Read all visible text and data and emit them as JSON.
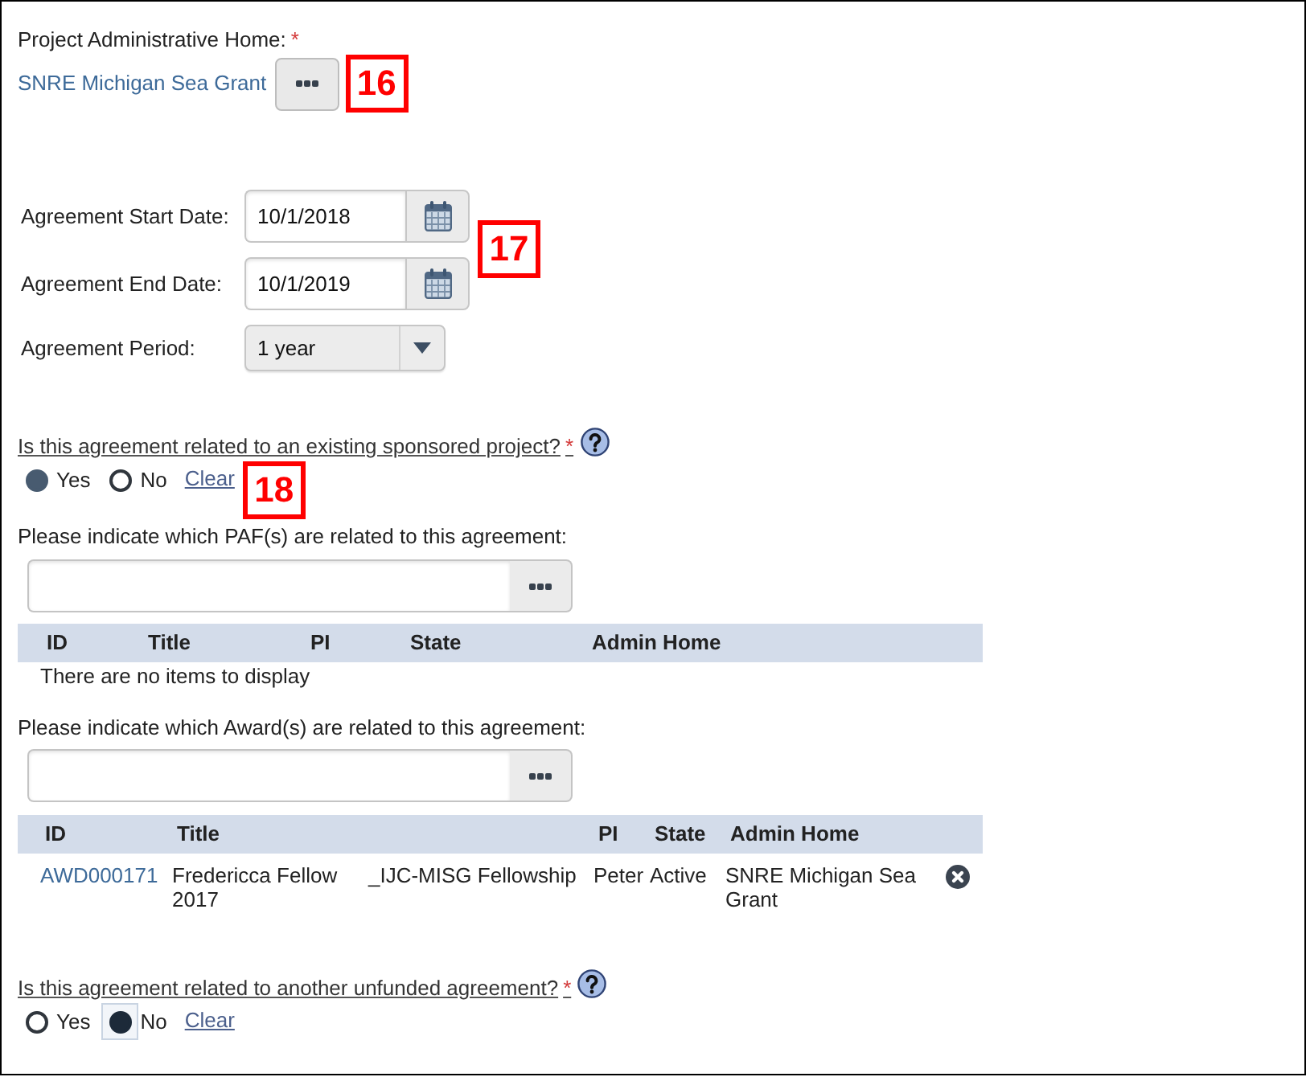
{
  "admin_home": {
    "label": "Project Administrative Home:",
    "required_mark": "*",
    "value": "SNRE Michigan Sea Grant",
    "callout": "16"
  },
  "agreement_dates": {
    "fields": [
      {
        "kind": "date",
        "label": "Agreement Start Date:",
        "value": "10/1/2018"
      },
      {
        "kind": "date",
        "label": "Agreement End Date:",
        "value": "10/1/2019"
      },
      {
        "kind": "select",
        "label": "Agreement Period:",
        "value": "1 year"
      }
    ],
    "callout": "17"
  },
  "sponsored_project_question": {
    "question": "Is this agreement related to an existing sponsored project?",
    "required_mark": "*",
    "options": [
      {
        "label": "Yes",
        "selected": true,
        "focused": false
      },
      {
        "label": "No",
        "selected": false,
        "focused": false
      }
    ],
    "clear": "Clear",
    "callout": "18"
  },
  "paf_lookup": {
    "label": "Please indicate which PAF(s) are related to this agreement:",
    "table": {
      "columns": [
        "ID",
        "Title",
        "PI",
        "State",
        "Admin Home"
      ],
      "empty_message": "There are no items to display"
    }
  },
  "award_lookup": {
    "label": "Please indicate which Award(s) are related to this agreement:",
    "table": {
      "columns": [
        "ID",
        "Title",
        "PI",
        "State",
        "Admin Home"
      ],
      "rows": [
        {
          "id": "AWD000171",
          "title": "Fredericca Fellow 2017",
          "column_3": "_IJC-MISG Fellowship",
          "pi": "Peter",
          "state": "Active",
          "admin_home": "SNRE Michigan Sea Grant"
        }
      ]
    }
  },
  "unfunded_agreement_question": {
    "question": "Is this agreement related to another unfunded agreement?",
    "required_mark": "*",
    "options": [
      {
        "label": "Yes",
        "selected": false,
        "focused": false
      },
      {
        "label": "No",
        "selected": true,
        "focused": true
      }
    ],
    "clear": "Clear"
  }
}
